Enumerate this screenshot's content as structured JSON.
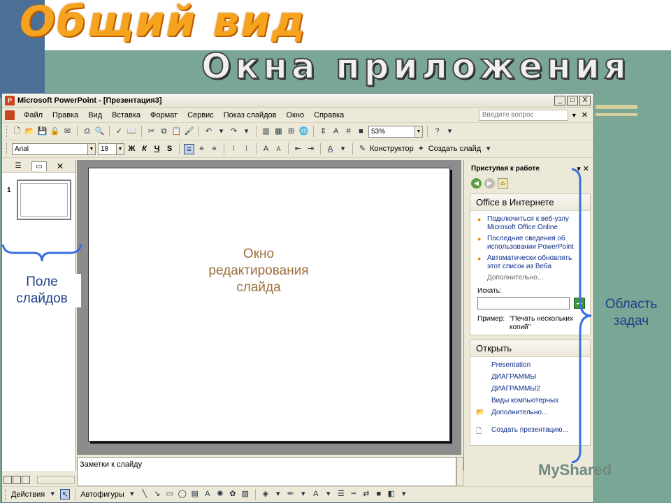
{
  "slide": {
    "title": "Общий вид",
    "subtitle": "Окна приложения"
  },
  "window": {
    "title": "Microsoft PowerPoint - [Презентация3]",
    "controls": [
      "_",
      "□",
      "X"
    ]
  },
  "menu": {
    "items": [
      "Файл",
      "Правка",
      "Вид",
      "Вставка",
      "Формат",
      "Сервис",
      "Показ слайдов",
      "Окно",
      "Справка"
    ],
    "help_placeholder": "Введите вопрос"
  },
  "toolbar_standard": {
    "zoom": "53%"
  },
  "toolbar_format": {
    "font": "Arial",
    "size": "18",
    "bold": "Ж",
    "italic": "К",
    "underline": "Ч",
    "shadow": "S",
    "designer": "Конструктор",
    "new_slide": "Создать слайд"
  },
  "slides_pane": {
    "slide_number": "1"
  },
  "notes": {
    "placeholder": "Заметки к слайду"
  },
  "task_pane": {
    "title": "Приступая к работе",
    "office_online": {
      "heading": "Office в Интернете",
      "links": [
        "Подключиться к веб-узлу Microsoft Office Online",
        "Последние сведения об использовании PowerPoint",
        "Автоматически обновлять этот список из Веба"
      ],
      "more": "Дополнительно..."
    },
    "search": {
      "label": "Искать:",
      "example_label": "Пример:",
      "example_text": "\"Печать нескольких копий\""
    },
    "open": {
      "heading": "Открыть",
      "files": [
        "Presentation",
        "ДИАГРАММЫ",
        "ДИАГРАММЫ2",
        "Виды компьютерных"
      ],
      "more": "Дополнительно...",
      "create": "Создать презентацию..."
    }
  },
  "drawing_toolbar": {
    "actions": "Действия",
    "autoshapes": "Автофигуры"
  },
  "annotations": {
    "slides_field": [
      "Поле",
      "слайдов"
    ],
    "edit_window": [
      "Окно",
      "редактирования",
      "слайда"
    ],
    "task_area": [
      "Область",
      "задач"
    ]
  },
  "watermark": "MyShared",
  "colors": {
    "title_orange": "#f6a31f",
    "background_green": "#7aa695",
    "annotation_blue": "#1d3f8a",
    "annotation_brown": "#9a6f39",
    "brace_blue": "#3a6fe0"
  }
}
